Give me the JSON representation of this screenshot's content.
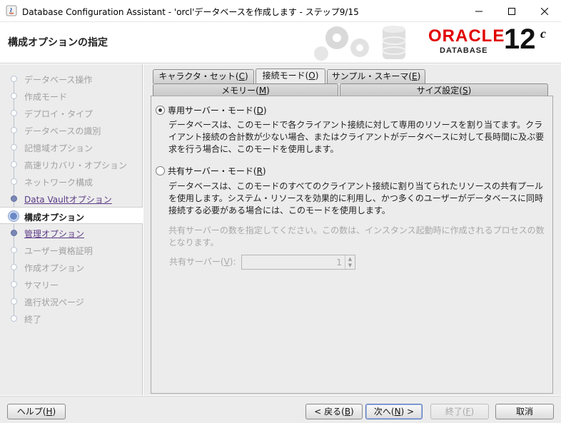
{
  "window": {
    "title": "Database Configuration Assistant - 'orcl'データベースを作成します - ステップ9/15"
  },
  "banner": {
    "title": "構成オプションの指定",
    "oracle": "ORACLE",
    "database": "DATABASE",
    "version": "12",
    "version_sup": "c"
  },
  "steps": [
    {
      "label": "データベース操作",
      "state": "inactive"
    },
    {
      "label": "作成モード",
      "state": "inactive"
    },
    {
      "label": "デプロイ・タイプ",
      "state": "inactive"
    },
    {
      "label": "データベースの識別",
      "state": "inactive"
    },
    {
      "label": "記憶域オプション",
      "state": "inactive"
    },
    {
      "label": "高速リカバリ・オプション",
      "state": "inactive"
    },
    {
      "label": "ネットワーク構成",
      "state": "inactive"
    },
    {
      "label": "Data Vaultオプション",
      "state": "link"
    },
    {
      "label": "構成オプション",
      "state": "current"
    },
    {
      "label": "管理オプション",
      "state": "link"
    },
    {
      "label": "ユーザー資格証明",
      "state": "inactive"
    },
    {
      "label": "作成オプション",
      "state": "inactive"
    },
    {
      "label": "サマリー",
      "state": "inactive"
    },
    {
      "label": "進行状況ページ",
      "state": "inactive"
    },
    {
      "label": "終了",
      "state": "inactive"
    }
  ],
  "tabs": {
    "charset": {
      "label": "キャラクタ・セット(",
      "mnemonic": "C",
      "close": ")"
    },
    "conn_mode": {
      "label": "接続モード(",
      "mnemonic": "O",
      "close": ")"
    },
    "sample": {
      "label": "サンプル・スキーマ(",
      "mnemonic": "E",
      "close": ")"
    },
    "memory": {
      "label": "メモリー(",
      "mnemonic": "M",
      "close": ")"
    },
    "sizing": {
      "label": "サイズ設定(",
      "mnemonic": "S",
      "close": ")"
    }
  },
  "dedicated": {
    "label": "専用サーバー・モード(",
    "mnemonic": "D",
    "close": ")",
    "selected": true,
    "desc": "データベースは、このモードで各クライアント接続に対して専用のリソースを割り当てます。クライアント接続の合計数が少ない場合、またはクライアントがデータベースに対して長時間に及ぶ要求を行う場合に、このモードを使用します。"
  },
  "shared": {
    "label": "共有サーバー・モード(",
    "mnemonic": "R",
    "close": ")",
    "selected": false,
    "desc": "データベースは、このモードのすべてのクライアント接続に割り当てられたリソースの共有プールを使用します。システム・リソースを効果的に利用し、かつ多くのユーザーがデータベースに同時接続する必要がある場合には、このモードを使用します。",
    "hint": "共有サーバーの数を指定してください。この数は、インスタンス起動時に作成されるプロセスの数となります。",
    "spinner_label": "共有サーバー(",
    "spinner_mnemonic": "V",
    "spinner_close": "):",
    "spinner_value": "1"
  },
  "buttons": {
    "help": {
      "label": "ヘルプ(",
      "mnemonic": "H",
      "close": ")"
    },
    "back": {
      "label": "< 戻る(",
      "mnemonic": "B",
      "close": ")"
    },
    "next": {
      "label": "次へ(",
      "mnemonic": "N",
      "close": ") >"
    },
    "finish": {
      "label": "終了(",
      "mnemonic": "F",
      "close": ")"
    },
    "cancel": {
      "label": "取消"
    }
  },
  "colors": {
    "oracle_red": "#e10000",
    "current_step_dot": "#6a88c6",
    "link_step": "#5b3b86"
  }
}
